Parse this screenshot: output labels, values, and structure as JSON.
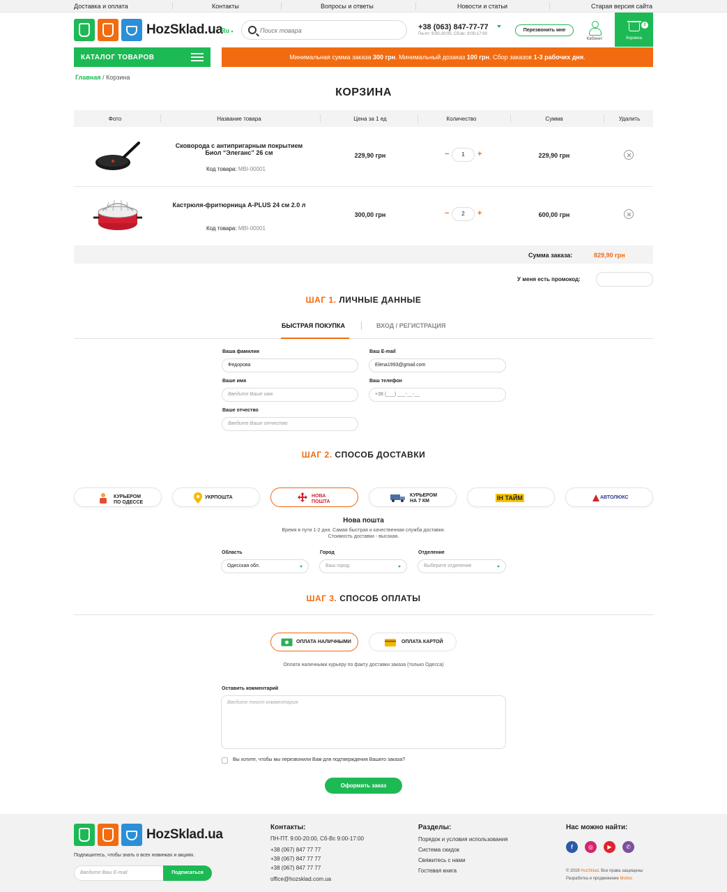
{
  "topnav": [
    "Доставка и оплата",
    "Контакты",
    "Вопросы и ответы",
    "Новости и статьи",
    "Старая версия сайта"
  ],
  "header": {
    "logo_text": "HozSklad.ua",
    "lang": "Ru",
    "search_placeholder": "Поиск товара",
    "phone": "+38 (063) 847-77-77",
    "hours": "Пн-пт: 9:00-20:00, Сб-вс: 9:00-17:00",
    "callback": "Перезвонить мне",
    "cabinet": "Кабинет",
    "cart": "Корзина",
    "cart_count": "2"
  },
  "catalog_label": "КАТАЛОГ ТОВАРОВ",
  "notice": {
    "p1": "Минимальная сумма заказа ",
    "v1": "300 грн",
    "p2": ". Минимальный дозаказ ",
    "v2": "100 грн",
    "p3": ". Сбор заказов ",
    "v3": "1-3 рабочих дня",
    "p4": "."
  },
  "breadcrumb": {
    "home": "Главная",
    "sep": " / ",
    "current": "Корзина"
  },
  "page_title": "КОРЗИНА",
  "table": {
    "headers": [
      "Фото",
      "Название товара",
      "Цена за 1 ед",
      "Количество",
      "Сумма",
      "Удалить"
    ],
    "code_label": "Код товара:",
    "rows": [
      {
        "name": "Сковорода с антипригарным покрытием Биол “Элеганс” 26 см",
        "code": "MBI-00001",
        "price": "229,90 грн",
        "qty": "1",
        "sum": "229,90 грн"
      },
      {
        "name": "Кастрюля-фритюрница A-PLUS 24 см 2.0 л",
        "code": "MBI-00001",
        "price": "300,00 грн",
        "qty": "2",
        "sum": "600,00 грн"
      }
    ],
    "total_label": "Сумма заказа:",
    "total_value": "829,90 грн"
  },
  "promo_label": "У меня есть промокод:",
  "step1": {
    "num": "ШАГ 1.",
    "title": " ЛИЧНЫЕ ДАННЫЕ"
  },
  "tabs": {
    "quick": "БЫСТРАЯ ПОКУПКА",
    "login": "ВХОД / РЕГИСТРАЦИЯ"
  },
  "form": {
    "surname_label": "Ваша фамилия",
    "surname_value": "Федорова",
    "name_label": "Ваше имя",
    "name_placeholder": "Введите Ваше имя",
    "patronymic_label": "Ваше отчество",
    "patronymic_placeholder": "Введите Ваше отчество",
    "email_label": "Ваш E-mail",
    "email_value": "Elena1993@gmail.com",
    "phone_label": "Ваш телефон",
    "phone_placeholder": "+38 (___) ___-__-__"
  },
  "step2": {
    "num": "ШАГ 2.",
    "title": " СПОСОБ ДОСТАВКИ"
  },
  "delivery": {
    "options": [
      {
        "l1": "КУРЬЕРОМ",
        "l2": "ПО ОДЕССЕ"
      },
      {
        "l1": "УКРПОШТА",
        "l2": ""
      },
      {
        "l1": "НОВА",
        "l2": "ПОШТА"
      },
      {
        "l1": "КУРЬЕРОМ",
        "l2": "НА 7 КМ"
      },
      {
        "l1": "ІН ТАЙМ",
        "l2": ""
      },
      {
        "l1": "АВТОЛЮКС",
        "l2": ""
      }
    ],
    "selected_name": "Нова пошта",
    "selected_desc": "Время в пути 1-2 дня. Самая быстрая и качественная служба доставки. Стоимость доставки - высокая.",
    "region_label": "Область",
    "region_value": "Одесская обл.",
    "city_label": "Город",
    "city_placeholder": "Ваш город",
    "branch_label": "Отделение",
    "branch_placeholder": "Выберите отделение"
  },
  "step3": {
    "num": "ШАГ 3.",
    "title": " СПОСОБ ОПЛАТЫ"
  },
  "payment": {
    "cash": "ОПЛАТА НАЛИЧНЫМИ",
    "card": "ОПЛАТА КАРТОЙ",
    "note": "Оплата наличными курьеру по факту доставки заказа (только Одесса)"
  },
  "comment_label": "Оставить комментарий",
  "comment_placeholder": "Введите текст комментария",
  "callback_question": "Вы хотите, чтобы мы перезвонили Вам для подтверждения Вашего заказа?",
  "submit": "Оформить заказ",
  "footer": {
    "subscribe_text": "Подпишитесь, чтобы знать о всех новинках и акциях.",
    "subscribe_placeholder": "Введите Ваш E-mail",
    "subscribe_button": "Подписаться",
    "contacts_title": "Контакты:",
    "contacts_hours": "ПН-ПТ. 9:00-20:00, Сб-Вс 9:00-17:00",
    "phones": [
      "+38 (067) 847 77 77",
      "+38 (067) 847 77 77",
      "+38 (067) 847 77 77"
    ],
    "email": "office@hozsklad.com.ua",
    "sections_title": "Разделы:",
    "sections": [
      "Порядок и условия использования",
      "Система скидок",
      "Свяжитесь с нами",
      "Гостевая книга"
    ],
    "social_title": "Нас можно найти:",
    "copyright_p1": "© 2019 ",
    "copyright_brand": "HozSklad",
    "copyright_p2": ". Все права защищены",
    "dev_p1": "Разработка и продвижение ",
    "dev_brand": "Motios"
  },
  "colors": {
    "green": "#1db954",
    "orange": "#f26b10"
  }
}
